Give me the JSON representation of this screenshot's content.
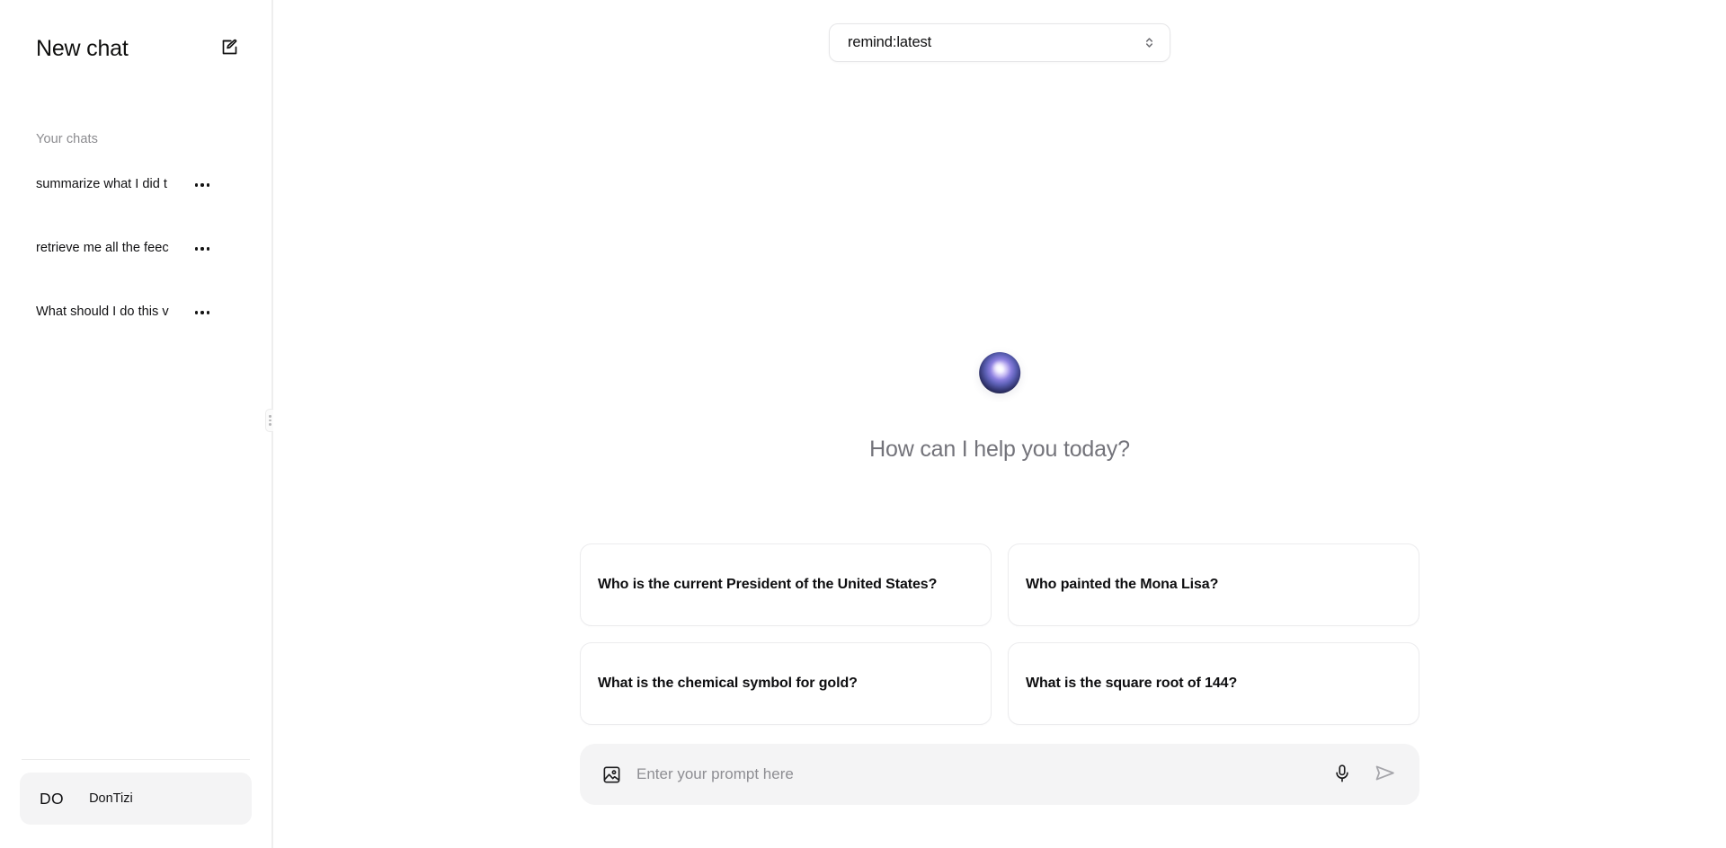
{
  "sidebar": {
    "title": "New chat",
    "compose_icon": "compose-pencil-square-icon",
    "section_label": "Your chats",
    "chats": [
      {
        "title": "summarize what I did t",
        "menu_icon": "more-horizontal-icon"
      },
      {
        "title": "retrieve me all the feec",
        "menu_icon": "more-horizontal-icon"
      },
      {
        "title": "What should I do this v",
        "menu_icon": "more-horizontal-icon"
      }
    ],
    "user": {
      "initials": "DO",
      "name": "DonTizi"
    }
  },
  "main": {
    "model_selector": {
      "value": "remind:latest",
      "chevron_icon": "chevron-up-down-icon"
    },
    "brand_orb": "ai-orb-logo",
    "greeting": "How can I help you today?",
    "suggestions": [
      "Who is the current President of the United States?",
      "Who painted the Mona Lisa?",
      "What is the chemical symbol for gold?",
      "What is the square root of 144?"
    ],
    "composer": {
      "attach_icon": "image-upload-icon",
      "placeholder": "Enter your prompt here",
      "value": "",
      "mic_icon": "microphone-icon",
      "send_icon": "send-arrow-icon"
    }
  },
  "colors": {
    "background": "#ffffff",
    "sidebar_bg": "#ffffff",
    "muted_text": "#8b8b8f",
    "greeting_text": "#73737a",
    "card_border": "#ececee",
    "composer_bg": "#f4f4f5",
    "user_card_bg": "#f4f4f5",
    "send_icon": "#a5a5aa"
  }
}
